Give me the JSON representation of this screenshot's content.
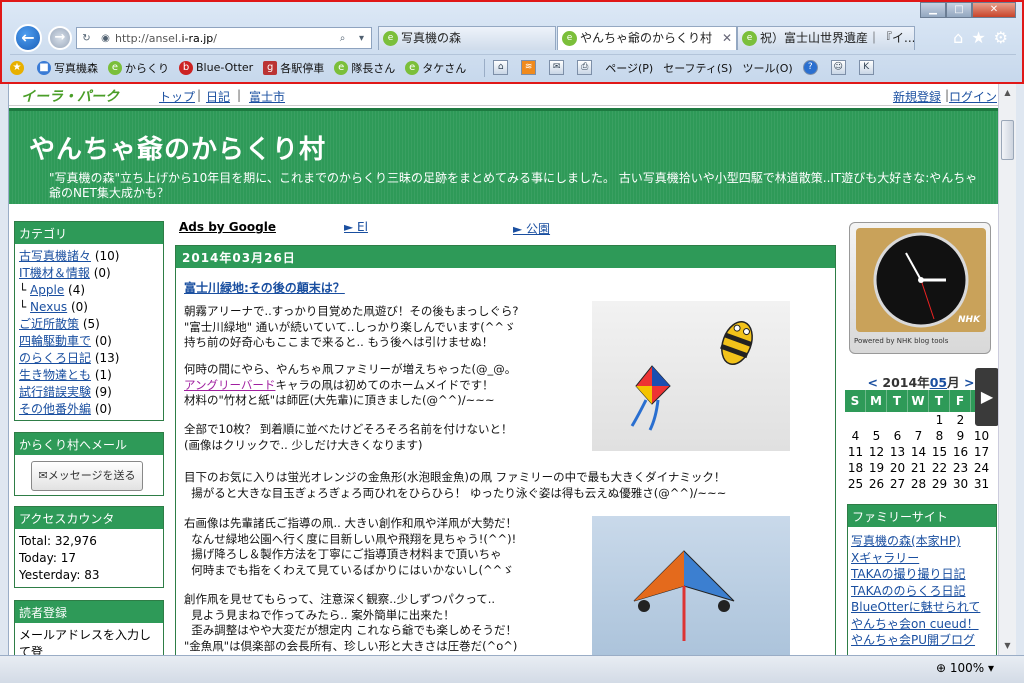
{
  "browser": {
    "address": {
      "url_prefix": "http://ansel.",
      "url_domain": "i-ra.jp",
      "url_suffix": "/"
    },
    "tabs": [
      {
        "label": "写真機の森"
      },
      {
        "label": "やんちゃ爺のからくり村",
        "close": "✕"
      },
      {
        "label": "祝）富士山世界遺産｜『イ..."
      }
    ],
    "favorites": [
      {
        "label": "写真機森"
      },
      {
        "label": "からくり"
      },
      {
        "label": "Blue-Otter"
      },
      {
        "label": "各駅停車"
      },
      {
        "label": "隊長さん"
      },
      {
        "label": "タケさん"
      }
    ],
    "commands": {
      "page": "ページ(P)",
      "safety": "セーフティ(S)",
      "tools": "ツール(O)"
    },
    "zoom": "100%"
  },
  "site": {
    "logo": "イーラ・パーク",
    "nav": {
      "top": "トップ",
      "diary": "日記",
      "fuji": "富士市"
    },
    "register": "新規登録",
    "login": "ログイン"
  },
  "banner": {
    "title": "やんちゃ爺のからくり村",
    "desc": "\"写真機の森\"立ち上げから10年目を期に、これまでのからくり三昧の足跡をまとめてみる事にしました。 古い写真機拾いや小型四駆で林道散策..IT遊びも大好きな:やんちゃ爺のNET集大成かも？"
  },
  "sidebar": {
    "category": {
      "title": "カテゴリ",
      "items": [
        {
          "label": "古写真機諸々",
          "count": "(10)"
        },
        {
          "label": "IT機材＆情報",
          "count": "(0)"
        },
        {
          "label": "Apple",
          "count": "(4)"
        },
        {
          "label": "Nexus",
          "count": "(0)"
        },
        {
          "label": "ご近所散策",
          "count": "(5)"
        },
        {
          "label": "四輪駆動車で",
          "count": "(0)"
        },
        {
          "label": "のらくろ日記",
          "count": "(13)"
        },
        {
          "label": "生き物達とも",
          "count": "(1)"
        },
        {
          "label": "試行錯誤実験",
          "count": "(9)"
        },
        {
          "label": "その他番外編",
          "count": "(0)"
        }
      ]
    },
    "mail": {
      "title": "からくり村へメール",
      "button": "メッセージを送る"
    },
    "counter": {
      "title": "アクセスカウンタ",
      "total": "Total: 32,976",
      "today": "Today: 17",
      "yesterday": "Yesterday: 83"
    },
    "reader": {
      "title": "読者登録",
      "text": "メールアドレスを入力して登"
    }
  },
  "ads": {
    "label": "Ads by Google",
    "link1": "► El",
    "link2": "► 公園"
  },
  "post": {
    "date": "2014年03月26日",
    "title": "富士川緑地:その後の顛末は？",
    "para1": "朝霧アリーナで..すっかり目覚めた凧遊び！その後もまっしぐら?\n\"富士川緑地\" 通いが続いていて..しっかり楽しんでいます(^^ゞ\n持ち前の好奇心もここまで来ると.. もう後へは引けませぬ！",
    "para2a": "何時の間にやら、やんちゃ凧ファミリーが増えちゃった(@_@。",
    "para2_link": "アングリーバード",
    "para2b": "キャラの凧は初めてのホームメイドです！",
    "para2c": "材料の\"竹材と紙\"は師匠(大先輩)に頂きました(@^^)/~~~",
    "para3": "全部で10枚？ 到着順に並べたけどそろそろ名前を付けないと！\n(画像はクリックで.. 少しだけ大きくなります)",
    "para4": "目下のお気に入りは蛍光オレンジの金魚形(水泡眼金魚)の凧 ファミリーの中で最も大きくダイナミック！\n  揚がると大きな目玉ぎょろぎょろ両ひれをひらひら！ ゆったり泳ぐ姿は得も云えぬ優雅さ(@^^)/~~~",
    "para5": "右画像は先輩諸氏ご指導の凧.. 大きい創作和凧や洋凧が大勢だ！\n  なんせ緑地公園へ行く度に目新しい凧や飛翔を見ちゃう!(^^)!\n  揚げ降ろし＆製作方法を丁寧にご指導頂き材料まで頂いちゃ\n  何時までも指をくわえて見ているばかりにはいかないし(^^ゞ",
    "para6": "創作凧を見せてもらって、注意深く観察..少しずつパクって..\n  見よう見まねで作ってみたら.. 案外簡単に出来た！\n  歪み調整はやや大変だが想定内 これなら爺でも楽しめそうだ！\n\"金魚凧\"は倶楽部の会長所有、珍しい形と大きさは圧巻だ(^o^)"
  },
  "clock": {
    "brand": "Powered by NHK blog tools",
    "logo": "NHK"
  },
  "calendar": {
    "prev": "<",
    "year": "2014年",
    "month": "05",
    "month_suffix": "月",
    "next": ">",
    "weekdays": [
      "S",
      "M",
      "T",
      "W",
      "T",
      "F",
      "S"
    ],
    "days": [
      "",
      "",
      "",
      "",
      "1",
      "2",
      "3",
      "4",
      "5",
      "6",
      "7",
      "8",
      "9",
      "10",
      "11",
      "12",
      "13",
      "14",
      "15",
      "16",
      "17",
      "18",
      "19",
      "20",
      "21",
      "22",
      "23",
      "24",
      "25",
      "26",
      "27",
      "28",
      "29",
      "30",
      "31"
    ]
  },
  "family": {
    "title": "ファミリーサイト",
    "links": [
      "写真機の森(本家HP)",
      "Xギャラリー",
      "TAKAの撮り撮り日記",
      "TAKAののらくろ日記",
      "BlueOtterに魅せられて",
      "やんちゃ会on cueud！",
      "やんちゃ会PU開ブログ"
    ]
  }
}
